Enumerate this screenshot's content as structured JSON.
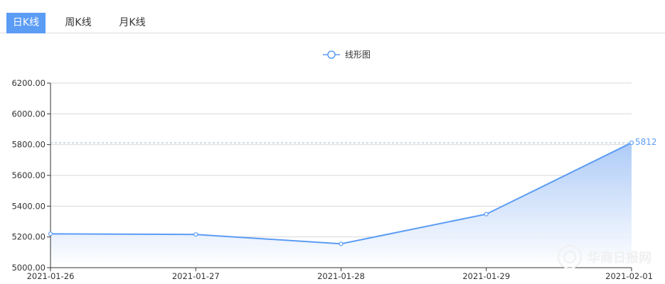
{
  "tabs": [
    {
      "label": "日K线",
      "active": true
    },
    {
      "label": "周K线",
      "active": false
    },
    {
      "label": "月K线",
      "active": false
    }
  ],
  "colors": {
    "line": "#5b9cf5",
    "area_top": "#a9c8f7",
    "area_bottom": "#ffffff",
    "grid": "#d9d9d9",
    "axis": "#333333",
    "markline": "#9fb4c8",
    "end_label": "#5b9cf5",
    "tab_active_bg": "#5b9cf5"
  },
  "chart_data": {
    "type": "area",
    "legend": {
      "label": "线形图",
      "position": "top-center",
      "icon": "circle-line-icon"
    },
    "x": [
      "2021-01-26",
      "2021-01-27",
      "2021-01-28",
      "2021-01-29",
      "2021-02-01"
    ],
    "series": [
      {
        "name": "线形图",
        "values": [
          5220,
          5216,
          5155,
          5348,
          5812
        ]
      }
    ],
    "ylim": [
      5000,
      6200
    ],
    "yticks": [
      "6200.00",
      "6000.00",
      "5800.00",
      "5600.00",
      "5400.00",
      "5200.00",
      "5000.00"
    ],
    "grid": true,
    "markline": {
      "value": 5812,
      "style": "dashed"
    },
    "end_label": "5812"
  },
  "watermark": {
    "text": "华商日报网",
    "icon": "circle-logo-icon"
  }
}
